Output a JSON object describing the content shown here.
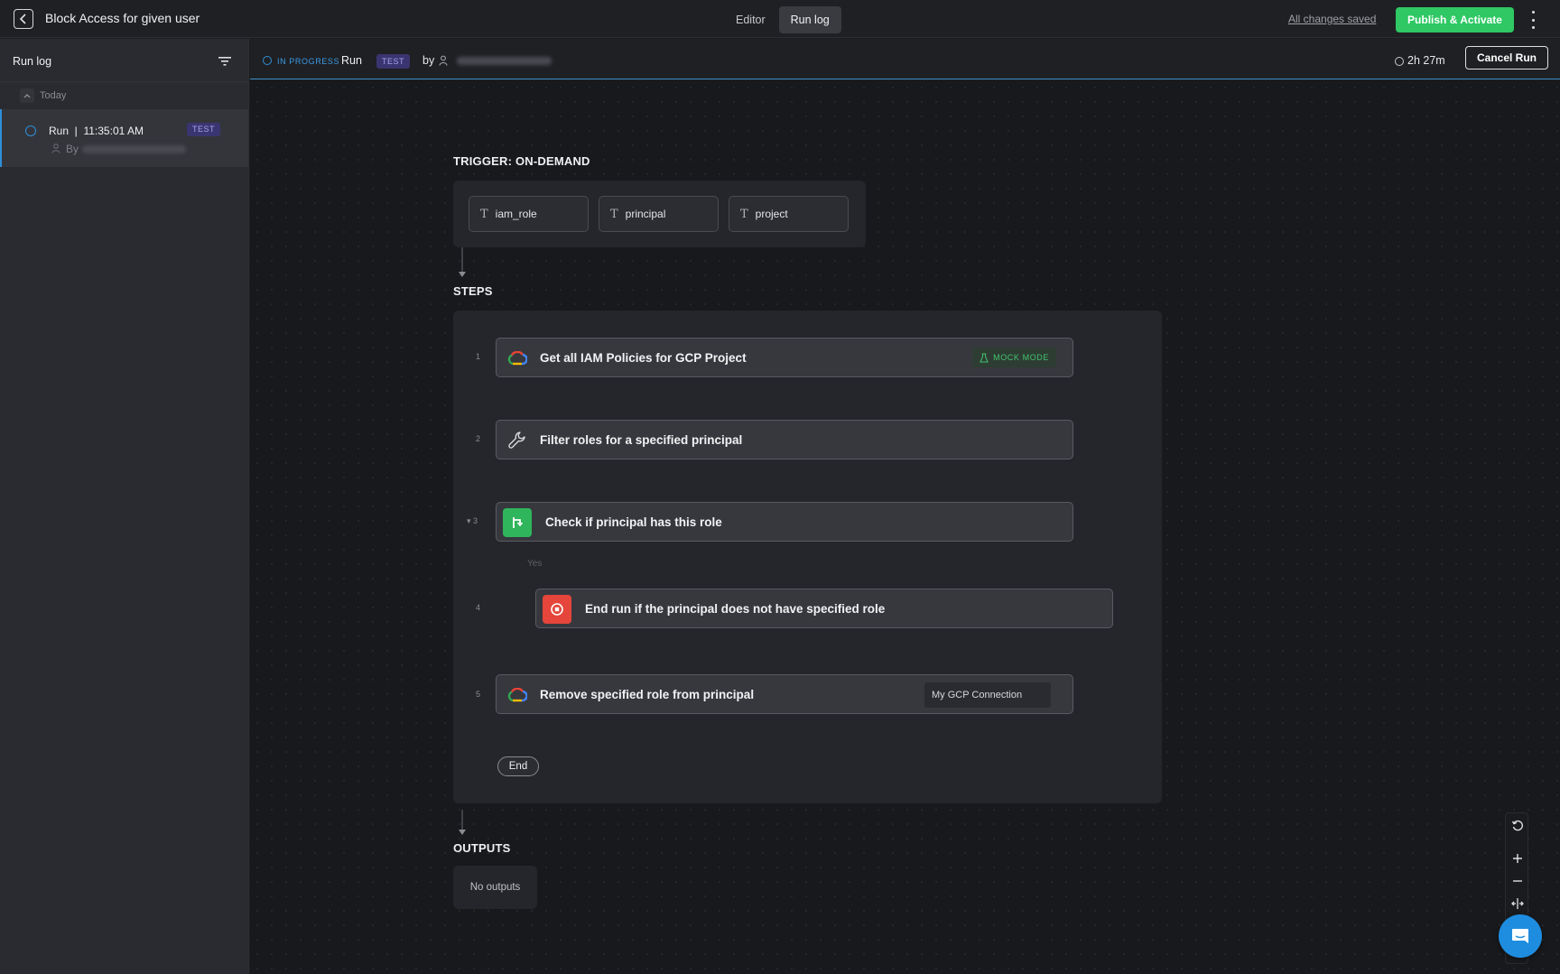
{
  "header": {
    "title": "Block Access for given user",
    "tabs": [
      {
        "label": "Editor",
        "active": false
      },
      {
        "label": "Run log",
        "active": true
      }
    ],
    "saved_status": "All changes saved",
    "publish_label": "Publish & Activate",
    "colors": {
      "publish": "#2fc864"
    }
  },
  "sidebar": {
    "title": "Run log",
    "group_label": "Today",
    "runs": [
      {
        "label": "Run  |  11:35:01 AM",
        "badge": "TEST",
        "by_label": "By",
        "status": "in-progress"
      }
    ]
  },
  "run_header": {
    "status": "IN PROGRESS",
    "run_label": "Run",
    "badge": "TEST",
    "by_label": "by",
    "duration": "2h 27m",
    "cancel_label": "Cancel Run",
    "colors": {
      "status": "#3a9be6",
      "badge_bg": "#3a3570"
    }
  },
  "trigger": {
    "title": "TRIGGER: ON-DEMAND",
    "params": [
      {
        "name": "iam_role",
        "type_icon": "text-type-icon"
      },
      {
        "name": "principal",
        "type_icon": "text-type-icon"
      },
      {
        "name": "project",
        "type_icon": "text-type-icon"
      }
    ]
  },
  "steps": {
    "title": "STEPS",
    "items": [
      {
        "num": "1",
        "title": "Get all IAM Policies for GCP Project",
        "icon": "google-cloud-icon",
        "badge": "MOCK MODE"
      },
      {
        "num": "2",
        "title": "Filter roles for a specified principal",
        "icon": "wrench-icon"
      },
      {
        "num": "3",
        "title": "Check if principal has this role",
        "icon": "branch-icon"
      },
      {
        "num": "4",
        "title": "End run if the principal does not have specified role",
        "icon": "stop-icon"
      },
      {
        "num": "5",
        "title": "Remove specified role from principal",
        "icon": "google-cloud-icon",
        "connection": "My GCP Connection"
      }
    ],
    "branch_label": "Yes",
    "end_label": "End"
  },
  "outputs": {
    "title": "OUTPUTS",
    "empty_text": "No outputs"
  },
  "zoom_controls": [
    "reset-icon",
    "zoom-in-icon",
    "zoom-out-icon",
    "fit-icon"
  ]
}
